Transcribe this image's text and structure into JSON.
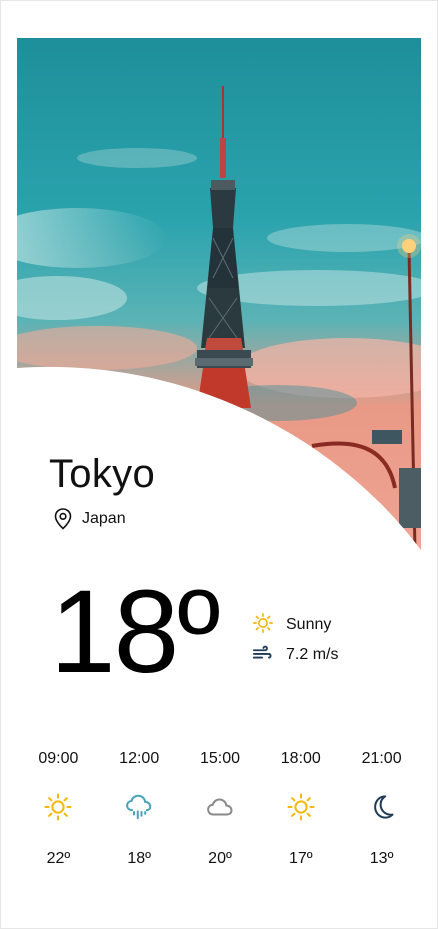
{
  "location": {
    "city": "Tokyo",
    "country": "Japan"
  },
  "current": {
    "temperature": "18º",
    "condition": "Sunny",
    "wind": "7.2 m/s"
  },
  "icons": {
    "location": "map-pin-icon",
    "condition": "sun-icon",
    "wind": "wind-icon"
  },
  "forecast": [
    {
      "time": "09:00",
      "icon": "sun-icon",
      "temp": "22º"
    },
    {
      "time": "12:00",
      "icon": "rain-cloud-icon",
      "temp": "18º"
    },
    {
      "time": "15:00",
      "icon": "cloud-icon",
      "temp": "20º"
    },
    {
      "time": "18:00",
      "icon": "sun-icon",
      "temp": "17º"
    },
    {
      "time": "21:00",
      "icon": "moon-icon",
      "temp": "13º"
    }
  ],
  "colors": {
    "sun": "#f5b80a",
    "rain": "#4aa3b8",
    "cloud": "#8a8a8a",
    "moon": "#1f3b57",
    "wind": "#1f3b57"
  }
}
